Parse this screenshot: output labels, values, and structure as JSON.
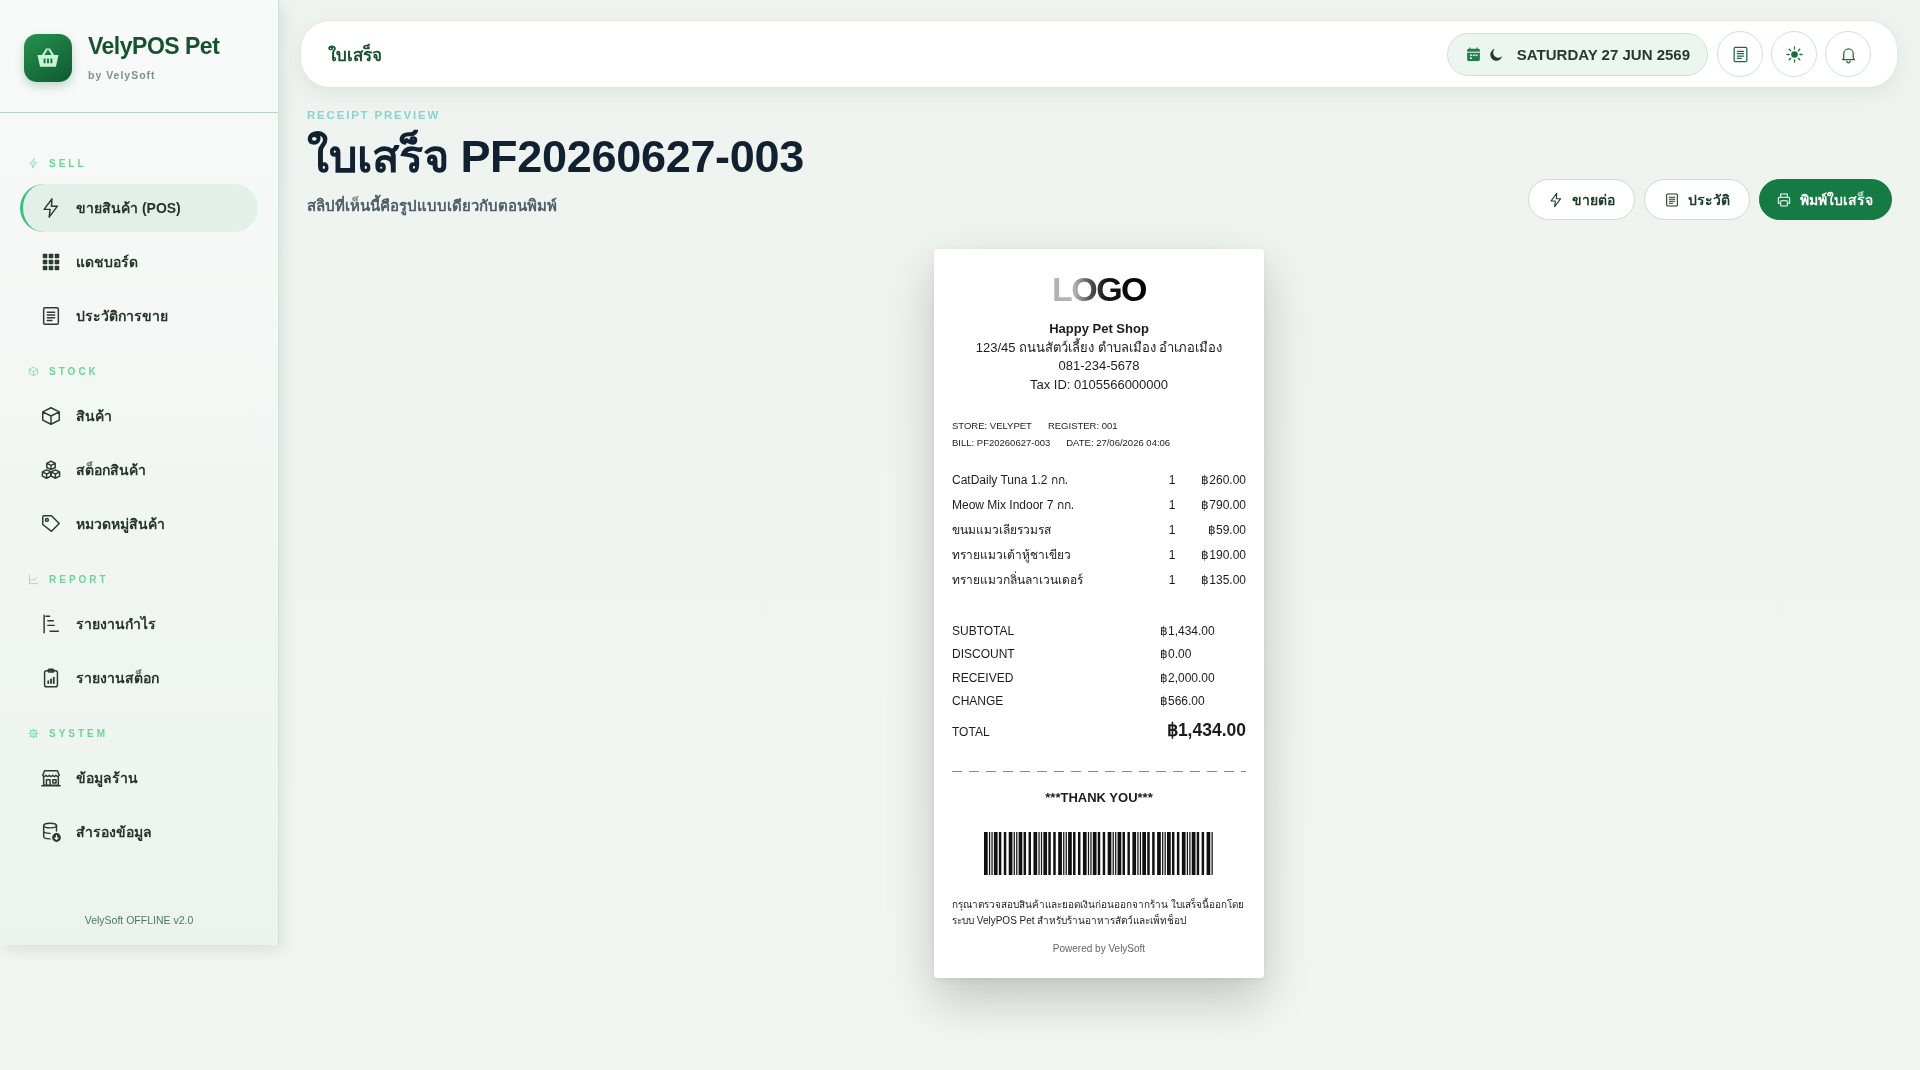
{
  "sidebar": {
    "brand": {
      "name": "VelyPOS Pet",
      "byline": "by VelySoft"
    },
    "sections": [
      {
        "title": "SELL",
        "items": [
          {
            "label": "ขายสินค้า (POS)",
            "selected": true
          },
          {
            "label": "แดชบอร์ด",
            "selected": false
          },
          {
            "label": "ประวัติการขาย",
            "selected": false
          }
        ]
      },
      {
        "title": "STOCK",
        "items": [
          {
            "label": "สินค้า",
            "selected": false
          },
          {
            "label": "สต็อกสินค้า",
            "selected": false
          },
          {
            "label": "หมวดหมู่สินค้า",
            "selected": false
          }
        ]
      },
      {
        "title": "REPORT",
        "items": [
          {
            "label": "รายงานกำไร",
            "selected": false
          },
          {
            "label": "รายงานสต็อก",
            "selected": false
          }
        ]
      },
      {
        "title": "SYSTEM",
        "items": [
          {
            "label": "ข้อมูลร้าน",
            "selected": false
          },
          {
            "label": "สำรองข้อมูล",
            "selected": false
          }
        ]
      }
    ],
    "footer": "VelySoft OFFLINE v2.0"
  },
  "topbar": {
    "title": "ใบเสร็จ",
    "date": "SATURDAY 27 JUN 2569"
  },
  "page": {
    "eyebrow": "RECEIPT PREVIEW",
    "title": "ใบเสร็จ PF20260627-003",
    "subtitle": "สลิปที่เห็นนี้คือรูปแบบเดียวกับตอนพิมพ์",
    "actions": [
      {
        "label": "ขายต่อ",
        "kind": "outline"
      },
      {
        "label": "ประวัติ",
        "kind": "outline"
      },
      {
        "label": "พิมพ์ใบเสร็จ",
        "kind": "primary"
      }
    ]
  },
  "receipt": {
    "logo": "LOGO",
    "shop_name": "Happy Pet Shop",
    "address": "123/45 ถนนสัตว์เลี้ยง ตำบลเมือง อำเภอเมือง",
    "phone": "081-234-5678",
    "tax_id": "Tax ID: 0105566000000",
    "meta": [
      [
        "STORE: VELYPET",
        "REGISTER: 001"
      ],
      [
        "BILL: PF20260627-003",
        "DATE: 27/06/2026 04:06"
      ]
    ],
    "items": [
      {
        "name": "CatDaily Tuna 1.2 กก.",
        "qty": "1",
        "price": "฿260.00"
      },
      {
        "name": "Meow Mix Indoor 7 กก.",
        "qty": "1",
        "price": "฿790.00"
      },
      {
        "name": "ขนมแมวเลียรวมรส",
        "qty": "1",
        "price": "฿59.00"
      },
      {
        "name": "ทรายแมวเต้าหู้ชาเขียว",
        "qty": "1",
        "price": "฿190.00"
      },
      {
        "name": "ทรายแมวกลิ่นลาเวนเดอร์",
        "qty": "1",
        "price": "฿135.00"
      }
    ],
    "totals": [
      {
        "label": "SUBTOTAL",
        "value": "฿1,434.00",
        "kind": "line"
      },
      {
        "label": "DISCOUNT",
        "value": "฿0.00",
        "kind": "line"
      },
      {
        "label": "RECEIVED",
        "value": "฿2,000.00",
        "kind": "line"
      },
      {
        "label": "CHANGE",
        "value": "฿566.00",
        "kind": "line"
      },
      {
        "label": "TOTAL",
        "value": "฿1,434.00",
        "kind": "grand"
      }
    ],
    "thank_you": "***THANK YOU***",
    "note": "กรุณาตรวจสอบสินค้าและยอดเงินก่อนออกจากร้าน ใบเสร็จนี้ออกโดยระบบ VelyPOS Pet สำหรับร้านอาหารสัตว์และเพ็ทช็อป",
    "powered_by": "Powered by VelySoft"
  }
}
